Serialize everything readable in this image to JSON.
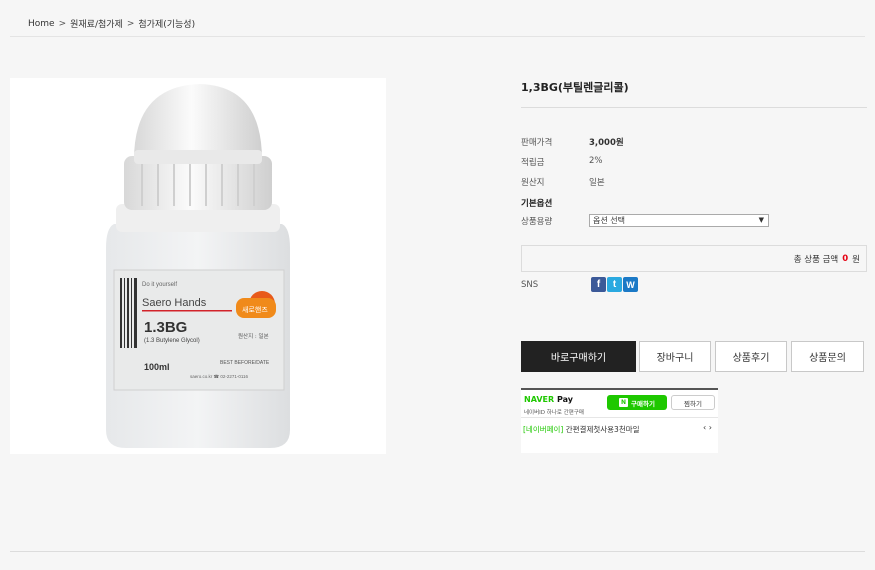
{
  "breadcrumb": {
    "home": "Home",
    "level1": "원재료/첨가제",
    "level2": "첨가제(기능성)",
    "separator": ">"
  },
  "product": {
    "title": "1,3BG(부틸렌글리콜)",
    "label": {
      "brand_small": "Do it yourself",
      "brand": "Saero Hands",
      "name": "1.3BG",
      "name_sub": "(1.3 Butylene Glycol)",
      "volume": "100ml",
      "origin_tag": "원산지 : 일본",
      "best_before": "BEST BEFORE/DATE",
      "site": "saero.co.kr ☎ 02-2271-0116"
    },
    "price_label": "판매가격",
    "price_value": "3,000원",
    "points_label": "적립금",
    "points_value": "2%",
    "origin_label": "원산지",
    "origin_value": "일본",
    "options_title": "기본옵션",
    "capacity_label": "상품용량",
    "capacity_select": "옵션 선택",
    "total_prefix": "총 상품 금액",
    "total_amount": "0",
    "total_suffix": "원",
    "sns_label": "SNS"
  },
  "sns_icons": [
    {
      "name": "facebook-icon",
      "glyph": "f"
    },
    {
      "name": "twitter-icon",
      "glyph": "t"
    },
    {
      "name": "w-share-icon",
      "glyph": "W"
    }
  ],
  "buttons": {
    "buy_now": "바로구매하기",
    "cart": "장바구니",
    "review": "상품후기",
    "inquiry": "상품문의"
  },
  "naverpay": {
    "brand_n": "NAVER",
    "brand_pay": " Pay",
    "sub": "네이버ID 하나로 간편구매",
    "buy": "구매하기",
    "buy_icon": "N",
    "wish": "찜하기",
    "event_tag": "[네이버페이]",
    "event_text": " 간편결제첫사용3천마일",
    "prev": "‹",
    "next": "›"
  },
  "colors": {
    "accent_red": "#e50012",
    "naver_green": "#1ec800",
    "primary_button": "#222222"
  }
}
